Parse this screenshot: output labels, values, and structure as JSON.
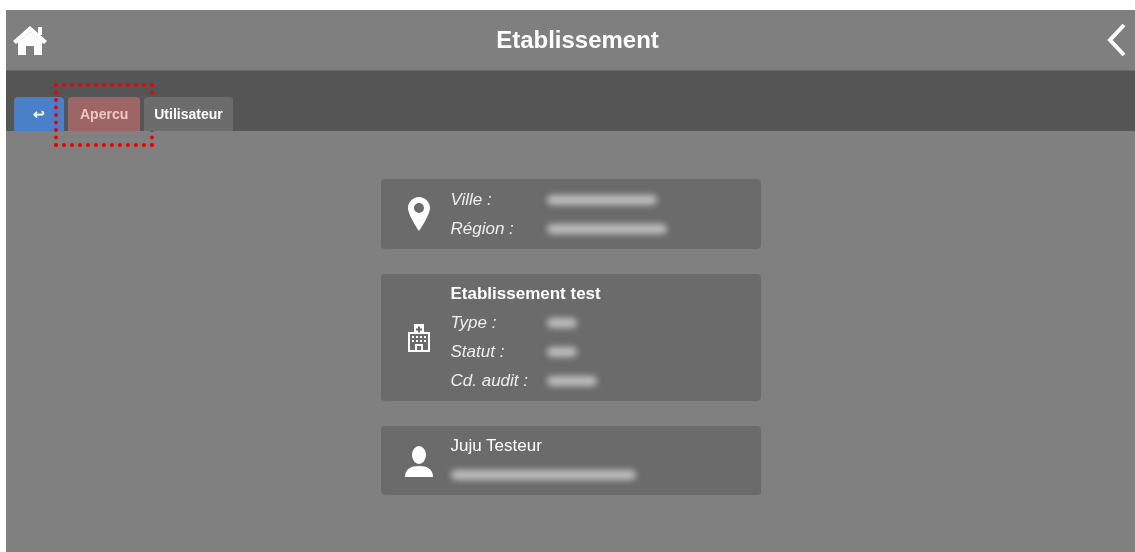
{
  "header": {
    "title": "Etablissement"
  },
  "tabs": [
    {
      "label": "↩",
      "kind": "back",
      "selected": false,
      "highlighted": false
    },
    {
      "label": "Apercu",
      "kind": "tab",
      "selected": true,
      "highlighted": true
    },
    {
      "label": "Utilisateur",
      "kind": "tab",
      "selected": false,
      "highlighted": false
    }
  ],
  "cards": [
    {
      "kind": "location",
      "fields": [
        {
          "label": "Ville :",
          "redacted": true
        },
        {
          "label": "Région :",
          "redacted": true
        }
      ]
    },
    {
      "kind": "facility",
      "title": "Etablissement test",
      "fields": [
        {
          "label": "Type :",
          "redacted": true
        },
        {
          "label": "Statut :",
          "redacted": true
        },
        {
          "label": "Cd. audit :",
          "redacted": true
        }
      ]
    },
    {
      "kind": "user",
      "title": "Juju Testeur",
      "subtitle_redacted": true
    }
  ]
}
